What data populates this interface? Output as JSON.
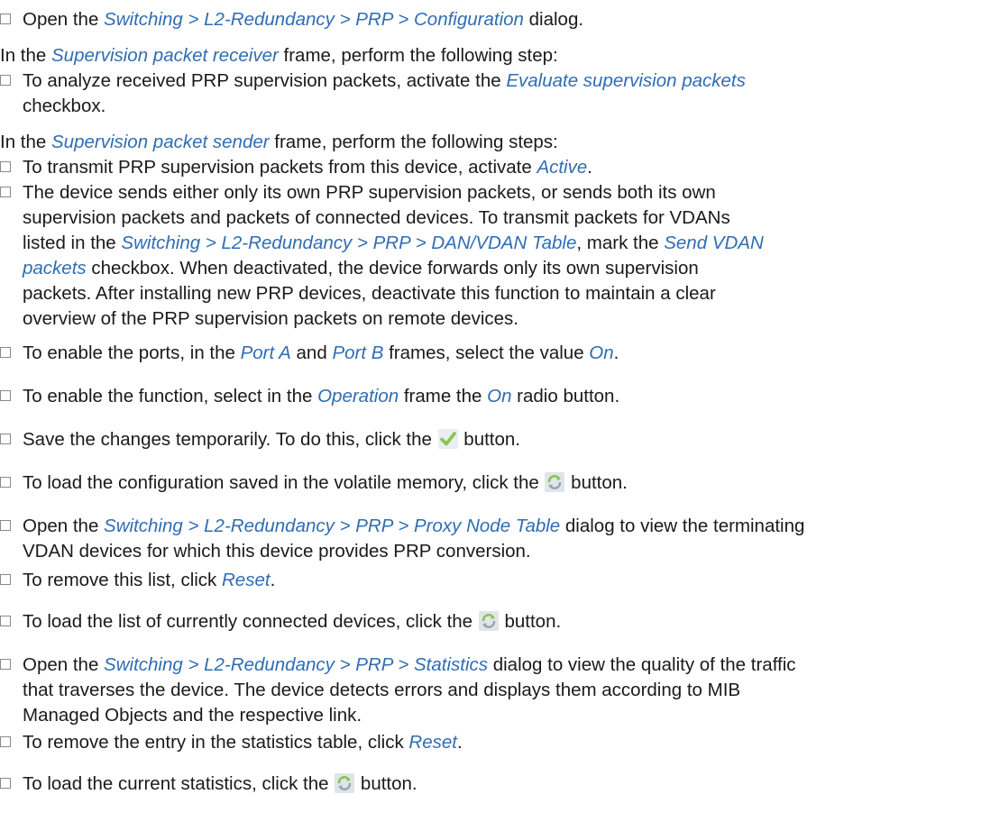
{
  "icons": {
    "save": "check-icon",
    "reload": "refresh-icon",
    "accent": "#2f6db3",
    "check_color": "#8bc34a",
    "reload_color": "#9aa6b2"
  },
  "steps": [
    {
      "pre": "Open the ",
      "ref": "Switching > L2-Redundancy > PRP > Configuration",
      "post": " dialog."
    },
    {
      "pre": "In the ",
      "ref": "Supervision packet receiver",
      "post": " frame, perform the following step:"
    },
    {
      "l1_pre": "To analyze received PRP supervision packets, activate the ",
      "l1_ref": "Evaluate supervision packets",
      "l2": "checkbox."
    },
    {
      "pre": "In the ",
      "ref": "Supervision packet sender",
      "post": " frame, perform the following steps:"
    },
    {
      "pre": "To transmit PRP supervision packets from this device, activate ",
      "ref": "Active",
      "post": "."
    },
    {
      "l1": "The device sends either only its own PRP supervision packets, or sends both its own",
      "l2": "supervision packets and packets of connected devices. To transmit packets for VDANs",
      "l3_pre": "listed in the ",
      "l3_ref": "Switching > L2-Redundancy > PRP > DAN/VDAN Table",
      "l3_mid": ", mark the ",
      "l3_ref2": "Send VDAN",
      "l4_ref": "packets",
      "l4_post": " checkbox. When deactivated, the device forwards only its own supervision",
      "l5": "packets. After installing new PRP devices, deactivate this function to maintain a clear",
      "l6": "overview of the PRP supervision packets on remote devices."
    },
    {
      "pre": "To enable the ports, in the ",
      "ref1": "Port A",
      "mid1": " and ",
      "ref2": "Port B",
      "mid2": " frames, select the value ",
      "ref3": "On",
      "post": "."
    },
    {
      "pre": "To enable the function, select in the ",
      "ref1": "Operation",
      "mid": " frame the ",
      "ref2": "On",
      "post": " radio button."
    },
    {
      "pre": "Save the changes temporarily. To do this, click the ",
      "post": " button."
    },
    {
      "pre": "To load the configuration saved in the volatile memory, click the ",
      "post": " button."
    },
    {
      "l1_pre": "Open the ",
      "l1_ref": "Switching > L2-Redundancy > PRP > Proxy Node Table",
      "l1_post": " dialog to view the terminating",
      "l2": "VDAN devices for which this device provides PRP conversion."
    },
    {
      "pre": "To remove this list, click ",
      "ref": "Reset",
      "post": "."
    },
    {
      "pre": "To load the list of currently connected devices, click the ",
      "post": " button."
    },
    {
      "l1_pre": "Open the ",
      "l1_ref": "Switching > L2-Redundancy > PRP > Statistics",
      "l1_post": " dialog to view the quality of the traffic",
      "l2": "that traverses the device. The device detects errors and displays them according to MIB",
      "l3": "Managed Objects and the respective link."
    },
    {
      "pre": "To remove the entry in the statistics table, click ",
      "ref": "Reset",
      "post": "."
    },
    {
      "pre": "To load the current statistics, click the ",
      "post": " button."
    }
  ]
}
